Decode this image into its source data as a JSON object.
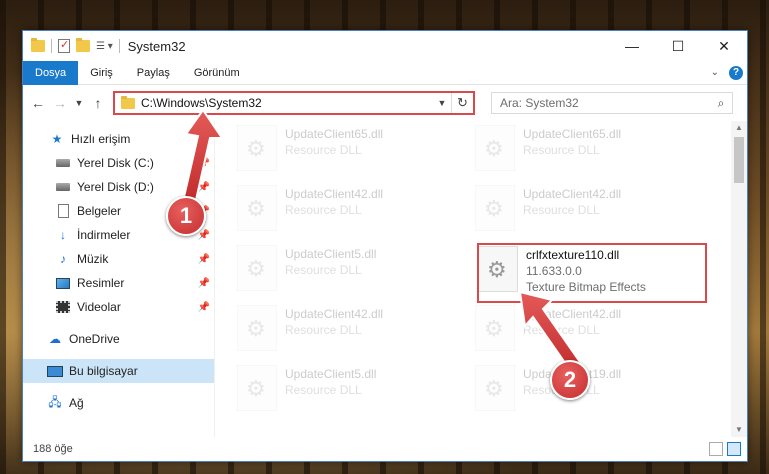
{
  "window": {
    "title": "System32",
    "controls": {
      "minimize": "—",
      "maximize": "☐",
      "close": "✕"
    }
  },
  "ribbon": {
    "tabs": [
      "Dosya",
      "Giriş",
      "Paylaş",
      "Görünüm"
    ],
    "help": "?"
  },
  "address": {
    "path": "C:\\Windows\\System32",
    "search_placeholder": "Ara: System32"
  },
  "sidebar": {
    "items": [
      {
        "label": "Hızlı erişim",
        "icon": "star-icon",
        "pinned": false
      },
      {
        "label": "Yerel Disk (C:)",
        "icon": "drive-icon",
        "pinned": true
      },
      {
        "label": "Yerel Disk (D:)",
        "icon": "drive-icon",
        "pinned": true
      },
      {
        "label": "Belgeler",
        "icon": "documents-icon",
        "pinned": true
      },
      {
        "label": "İndirmeler",
        "icon": "downloads-icon",
        "pinned": true
      },
      {
        "label": "Müzik",
        "icon": "music-icon",
        "pinned": true
      },
      {
        "label": "Resimler",
        "icon": "pictures-icon",
        "pinned": true
      },
      {
        "label": "Videolar",
        "icon": "videos-icon",
        "pinned": true
      },
      {
        "label": "OneDrive",
        "icon": "onedrive-icon",
        "pinned": false
      },
      {
        "label": "Bu bilgisayar",
        "icon": "computer-icon",
        "pinned": false,
        "selected": true
      },
      {
        "label": "Ağ",
        "icon": "network-icon",
        "pinned": false
      }
    ]
  },
  "files": [
    {
      "name": "UpdateClient65.dll",
      "type": "Resource DLL"
    },
    {
      "name": "UpdateClient65.dll",
      "type": "Resource DLL"
    },
    {
      "name": "UpdateClient42.dll",
      "type": "Resource DLL"
    },
    {
      "name": "UpdateClient42.dll",
      "type": "Resource DLL"
    },
    {
      "name": "UpdateClient5.dll",
      "type": "Resource DLL"
    },
    {
      "name": "crlfxtexture110.dll",
      "version": "11.633.0.0",
      "type": "Texture Bitmap Effects"
    },
    {
      "name": "UpdateClient42.dll",
      "type": "Resource DLL"
    },
    {
      "name": "UpdateClient42.dll",
      "type": "Resource DLL"
    },
    {
      "name": "UpdateClient5.dll",
      "type": "Resource DLL"
    },
    {
      "name": "UpdateClient19.dll",
      "type": "Resource DLL"
    }
  ],
  "status": {
    "count": "188 öğe"
  },
  "annotations": {
    "step1": "1",
    "step2": "2"
  },
  "colors": {
    "accent": "#1979ca",
    "highlight": "#d9484a"
  }
}
